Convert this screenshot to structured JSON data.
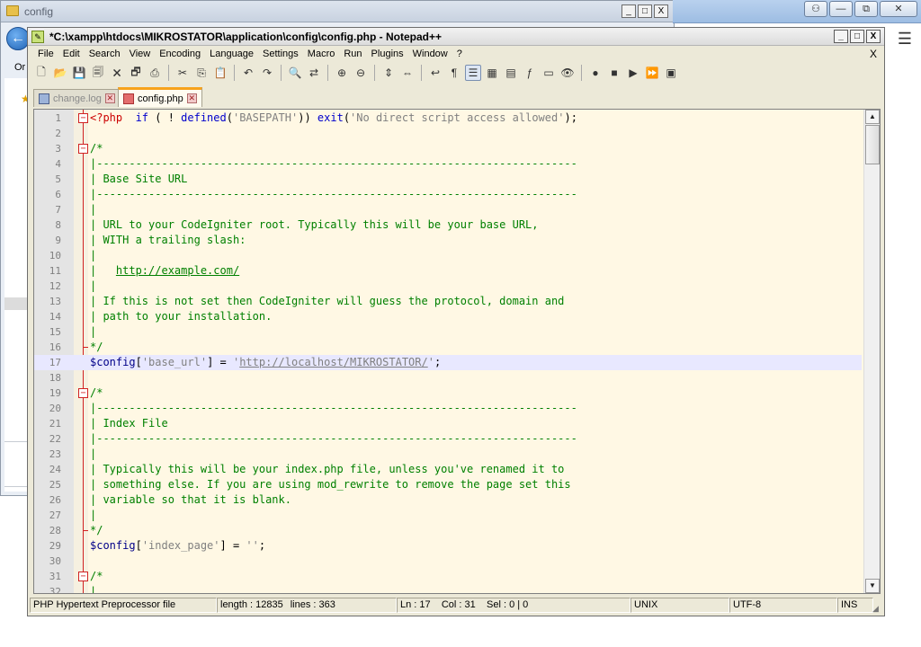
{
  "background_explorer": {
    "title": "config",
    "toolbar_text": "Or",
    "controls": [
      "_",
      "□",
      "X"
    ]
  },
  "background_right": {
    "controls": [
      "⚇",
      "—",
      "⧉",
      "✕"
    ]
  },
  "npp": {
    "title": "*C:\\xampp\\htdocs\\MIKROSTATOR\\application\\config\\config.php - Notepad++",
    "controls": [
      "_",
      "□",
      "X"
    ],
    "menu": [
      "File",
      "Edit",
      "Search",
      "View",
      "Encoding",
      "Language",
      "Settings",
      "Macro",
      "Run",
      "Plugins",
      "Window",
      "?"
    ],
    "menu_close": "X",
    "toolbar": [
      {
        "name": "new-file-icon",
        "glyph": "🗋"
      },
      {
        "name": "open-file-icon",
        "glyph": "📂"
      },
      {
        "name": "save-icon",
        "glyph": "💾"
      },
      {
        "name": "save-all-icon",
        "glyph": "🗐"
      },
      {
        "name": "close-file-icon",
        "glyph": "🗙"
      },
      {
        "name": "close-all-icon",
        "glyph": "🗗"
      },
      {
        "name": "print-icon",
        "glyph": "⎙"
      },
      {
        "sep": true
      },
      {
        "name": "cut-icon",
        "glyph": "✂"
      },
      {
        "name": "copy-icon",
        "glyph": "⎘"
      },
      {
        "name": "paste-icon",
        "glyph": "📋"
      },
      {
        "sep": true
      },
      {
        "name": "undo-icon",
        "glyph": "↶"
      },
      {
        "name": "redo-icon",
        "glyph": "↷"
      },
      {
        "sep": true
      },
      {
        "name": "find-icon",
        "glyph": "🔍"
      },
      {
        "name": "replace-icon",
        "glyph": "⇄"
      },
      {
        "sep": true
      },
      {
        "name": "zoom-in-icon",
        "glyph": "⊕"
      },
      {
        "name": "zoom-out-icon",
        "glyph": "⊖"
      },
      {
        "sep": true
      },
      {
        "name": "sync-vertical-icon",
        "glyph": "⇕"
      },
      {
        "name": "sync-horizontal-icon",
        "glyph": "⇔"
      },
      {
        "sep": true
      },
      {
        "name": "word-wrap-icon",
        "glyph": "↩"
      },
      {
        "name": "show-all-chars-icon",
        "glyph": "¶"
      },
      {
        "name": "indent-guide-icon",
        "glyph": "☰",
        "active": true
      },
      {
        "name": "udl-icon",
        "glyph": "▦"
      },
      {
        "name": "doc-map-icon",
        "glyph": "▤"
      },
      {
        "name": "function-list-icon",
        "glyph": "ƒ"
      },
      {
        "name": "folder-workspace-icon",
        "glyph": "▭"
      },
      {
        "name": "monitoring-icon",
        "glyph": "👁"
      },
      {
        "sep": true
      },
      {
        "name": "record-macro-icon",
        "glyph": "●"
      },
      {
        "name": "stop-macro-icon",
        "glyph": "■"
      },
      {
        "name": "play-macro-icon",
        "glyph": "▶"
      },
      {
        "name": "run-macro-multiple-icon",
        "glyph": "⏩"
      },
      {
        "name": "save-macro-icon",
        "glyph": "▣"
      }
    ],
    "tabs": [
      {
        "label": "change.log",
        "active": false
      },
      {
        "label": "config.php",
        "active": true
      }
    ],
    "lines": [
      {
        "n": "1",
        "fold": "open",
        "tokens": [
          [
            "php",
            "<?php"
          ],
          [
            "plain",
            "  "
          ],
          [
            "kw",
            "if"
          ],
          [
            "plain",
            " ( ! "
          ],
          [
            "kw",
            "defined"
          ],
          [
            "plain",
            "("
          ],
          [
            "str",
            "'BASEPATH'"
          ],
          [
            "plain",
            ")) "
          ],
          [
            "kw",
            "exit"
          ],
          [
            "plain",
            "("
          ],
          [
            "str",
            "'No direct script access allowed'"
          ],
          [
            "plain",
            ");"
          ]
        ]
      },
      {
        "n": "2",
        "tokens": []
      },
      {
        "n": "3",
        "fold": "open",
        "tokens": [
          [
            "cm",
            "/*"
          ]
        ]
      },
      {
        "n": "4",
        "tokens": [
          [
            "cm",
            "|--------------------------------------------------------------------------"
          ]
        ]
      },
      {
        "n": "5",
        "tokens": [
          [
            "cm",
            "| Base Site URL"
          ]
        ]
      },
      {
        "n": "6",
        "tokens": [
          [
            "cm",
            "|--------------------------------------------------------------------------"
          ]
        ]
      },
      {
        "n": "7",
        "tokens": [
          [
            "cm",
            "|"
          ]
        ]
      },
      {
        "n": "8",
        "tokens": [
          [
            "cm",
            "| URL to your CodeIgniter root. Typically this will be your base URL,"
          ]
        ]
      },
      {
        "n": "9",
        "tokens": [
          [
            "cm",
            "| WITH a trailing slash:"
          ]
        ]
      },
      {
        "n": "10",
        "tokens": [
          [
            "cm",
            "|"
          ]
        ]
      },
      {
        "n": "11",
        "tokens": [
          [
            "cm",
            "|   "
          ],
          [
            "cmurl",
            "http://example.com/"
          ]
        ]
      },
      {
        "n": "12",
        "tokens": [
          [
            "cm",
            "|"
          ]
        ]
      },
      {
        "n": "13",
        "tokens": [
          [
            "cm",
            "| If this is not set then CodeIgniter will guess the protocol, domain and"
          ]
        ]
      },
      {
        "n": "14",
        "tokens": [
          [
            "cm",
            "| path to your installation."
          ]
        ]
      },
      {
        "n": "15",
        "tokens": [
          [
            "cm",
            "|"
          ]
        ]
      },
      {
        "n": "16",
        "fold": "end",
        "tokens": [
          [
            "cm",
            "*/"
          ]
        ]
      },
      {
        "n": "17",
        "current": true,
        "tokens": [
          [
            "var",
            "$config"
          ],
          [
            "plain",
            "["
          ],
          [
            "str",
            "'base_url'"
          ],
          [
            "plain",
            "] = "
          ],
          [
            "str",
            "'"
          ],
          [
            "strurl",
            "http://localhost/MIKROSTATOR/"
          ],
          [
            "str",
            "'"
          ],
          [
            "plain",
            ";"
          ]
        ]
      },
      {
        "n": "18",
        "tokens": []
      },
      {
        "n": "19",
        "fold": "open",
        "tokens": [
          [
            "cm",
            "/*"
          ]
        ]
      },
      {
        "n": "20",
        "tokens": [
          [
            "cm",
            "|--------------------------------------------------------------------------"
          ]
        ]
      },
      {
        "n": "21",
        "tokens": [
          [
            "cm",
            "| Index File"
          ]
        ]
      },
      {
        "n": "22",
        "tokens": [
          [
            "cm",
            "|--------------------------------------------------------------------------"
          ]
        ]
      },
      {
        "n": "23",
        "tokens": [
          [
            "cm",
            "|"
          ]
        ]
      },
      {
        "n": "24",
        "tokens": [
          [
            "cm",
            "| Typically this will be your index.php file, unless you've renamed it to"
          ]
        ]
      },
      {
        "n": "25",
        "tokens": [
          [
            "cm",
            "| something else. If you are using mod_rewrite to remove the page set this"
          ]
        ]
      },
      {
        "n": "26",
        "tokens": [
          [
            "cm",
            "| variable so that it is blank."
          ]
        ]
      },
      {
        "n": "27",
        "tokens": [
          [
            "cm",
            "|"
          ]
        ]
      },
      {
        "n": "28",
        "fold": "end",
        "tokens": [
          [
            "cm",
            "*/"
          ]
        ]
      },
      {
        "n": "29",
        "tokens": [
          [
            "var",
            "$config"
          ],
          [
            "plain",
            "["
          ],
          [
            "str",
            "'index_page'"
          ],
          [
            "plain",
            "] = "
          ],
          [
            "str",
            "''"
          ],
          [
            "plain",
            ";"
          ]
        ]
      },
      {
        "n": "30",
        "tokens": []
      },
      {
        "n": "31",
        "fold": "open",
        "tokens": [
          [
            "cm",
            "/*"
          ]
        ]
      },
      {
        "n": "32",
        "tokens": [
          [
            "cm",
            "|"
          ]
        ]
      }
    ],
    "status": {
      "file_type": "PHP Hypertext Preprocessor file",
      "length": "length : 12835",
      "lines": "lines : 363",
      "position": "Ln : 17    Col : 31    Sel : 0 | 0",
      "eol": "UNIX",
      "encoding": "UTF-8",
      "mode": "INS"
    },
    "colors": {
      "editor_bg": "#fff8e4",
      "current_line": "#e8e8ff",
      "comment": "#008000",
      "keyword": "#0000cc",
      "string": "#808080",
      "php_tag": "#cc0000",
      "fold_marker": "#d12222"
    }
  }
}
